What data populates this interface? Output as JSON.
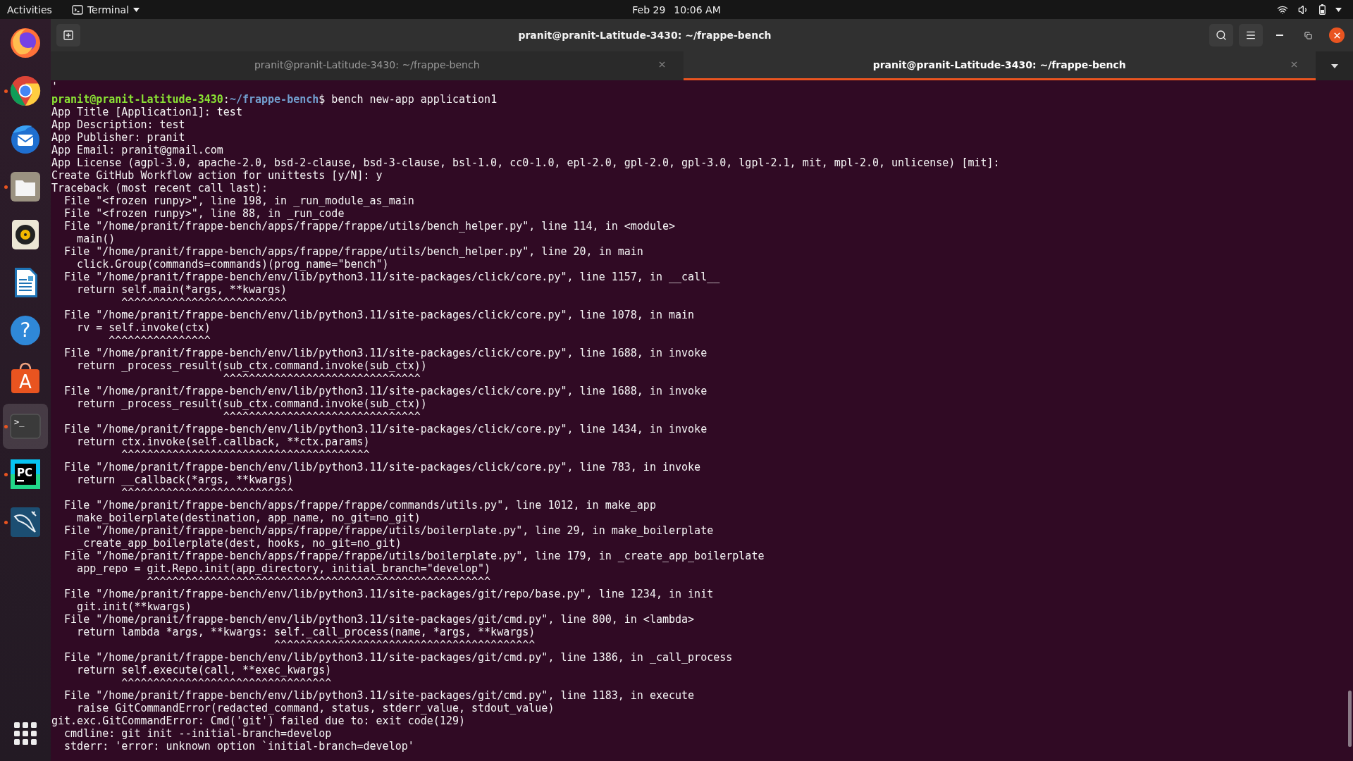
{
  "top_bar": {
    "activities": "Activities",
    "app_menu": "Terminal",
    "date": "Feb 29",
    "time": "10:06 AM"
  },
  "dock": [
    {
      "kind": "fox",
      "running": false,
      "selected": false
    },
    {
      "kind": "chrome",
      "running": true,
      "selected": false
    },
    {
      "kind": "mail",
      "running": false,
      "selected": false
    },
    {
      "kind": "files",
      "running": true,
      "selected": false
    },
    {
      "kind": "music",
      "running": false,
      "selected": false
    },
    {
      "kind": "document",
      "running": false,
      "selected": false
    },
    {
      "kind": "help",
      "label": "?",
      "running": false,
      "selected": false
    },
    {
      "kind": "store",
      "label": "A",
      "running": false,
      "selected": false
    },
    {
      "kind": "terminal",
      "label": ">_",
      "running": true,
      "selected": true
    },
    {
      "kind": "ide",
      "label": "PC",
      "running": true,
      "selected": false
    },
    {
      "kind": "database",
      "running": true,
      "selected": false
    }
  ],
  "window": {
    "title": "pranit@pranit-Latitude-3430: ~/frappe-bench"
  },
  "tabs": [
    {
      "title": "pranit@pranit-Latitude-3430: ~/frappe-bench",
      "selected": false
    },
    {
      "title": "pranit@pranit-Latitude-3430: ~/frappe-bench",
      "selected": true
    }
  ],
  "terminal": {
    "lines": [
      {
        "kind": "output",
        "text": "'"
      },
      {
        "kind": "prompt",
        "user": "pranit@pranit-Latitude-3430",
        "separator": ":",
        "path": "~/frappe-bench",
        "command": "$ bench new-app application1"
      },
      {
        "kind": "output",
        "text": "App Title [Application1]: test"
      },
      {
        "kind": "output",
        "text": "App Description: test"
      },
      {
        "kind": "output",
        "text": "App Publisher: pranit"
      },
      {
        "kind": "output",
        "text": "App Email: pranit@gmail.com"
      },
      {
        "kind": "output",
        "text": "App License (agpl-3.0, apache-2.0, bsd-2-clause, bsd-3-clause, bsl-1.0, cc0-1.0, epl-2.0, gpl-2.0, gpl-3.0, lgpl-2.1, mit, mpl-2.0, unlicense) [mit]:"
      },
      {
        "kind": "output",
        "text": "Create GitHub Workflow action for unittests [y/N]: y"
      },
      {
        "kind": "output",
        "text": "Traceback (most recent call last):"
      },
      {
        "kind": "output",
        "text": "  File \"<frozen runpy>\", line 198, in _run_module_as_main"
      },
      {
        "kind": "output",
        "text": "  File \"<frozen runpy>\", line 88, in _run_code"
      },
      {
        "kind": "output",
        "text": "  File \"/home/pranit/frappe-bench/apps/frappe/frappe/utils/bench_helper.py\", line 114, in <module>"
      },
      {
        "kind": "output",
        "text": "    main()"
      },
      {
        "kind": "output",
        "text": "  File \"/home/pranit/frappe-bench/apps/frappe/frappe/utils/bench_helper.py\", line 20, in main"
      },
      {
        "kind": "output",
        "text": "    click.Group(commands=commands)(prog_name=\"bench\")"
      },
      {
        "kind": "output",
        "text": "  File \"/home/pranit/frappe-bench/env/lib/python3.11/site-packages/click/core.py\", line 1157, in __call__"
      },
      {
        "kind": "output",
        "text": "    return self.main(*args, **kwargs)"
      },
      {
        "kind": "output",
        "text": "           ^^^^^^^^^^^^^^^^^^^^^^^^^^"
      },
      {
        "kind": "output",
        "text": "  File \"/home/pranit/frappe-bench/env/lib/python3.11/site-packages/click/core.py\", line 1078, in main"
      },
      {
        "kind": "output",
        "text": "    rv = self.invoke(ctx)"
      },
      {
        "kind": "output",
        "text": "         ^^^^^^^^^^^^^^^^"
      },
      {
        "kind": "output",
        "text": "  File \"/home/pranit/frappe-bench/env/lib/python3.11/site-packages/click/core.py\", line 1688, in invoke"
      },
      {
        "kind": "output",
        "text": "    return _process_result(sub_ctx.command.invoke(sub_ctx))"
      },
      {
        "kind": "output",
        "text": "                           ^^^^^^^^^^^^^^^^^^^^^^^^^^^^^^^"
      },
      {
        "kind": "output",
        "text": "  File \"/home/pranit/frappe-bench/env/lib/python3.11/site-packages/click/core.py\", line 1688, in invoke"
      },
      {
        "kind": "output",
        "text": "    return _process_result(sub_ctx.command.invoke(sub_ctx))"
      },
      {
        "kind": "output",
        "text": "                           ^^^^^^^^^^^^^^^^^^^^^^^^^^^^^^^"
      },
      {
        "kind": "output",
        "text": "  File \"/home/pranit/frappe-bench/env/lib/python3.11/site-packages/click/core.py\", line 1434, in invoke"
      },
      {
        "kind": "output",
        "text": "    return ctx.invoke(self.callback, **ctx.params)"
      },
      {
        "kind": "output",
        "text": "           ^^^^^^^^^^^^^^^^^^^^^^^^^^^^^^^^^^^^^^^"
      },
      {
        "kind": "output",
        "text": "  File \"/home/pranit/frappe-bench/env/lib/python3.11/site-packages/click/core.py\", line 783, in invoke"
      },
      {
        "kind": "output",
        "text": "    return __callback(*args, **kwargs)"
      },
      {
        "kind": "output",
        "text": "           ^^^^^^^^^^^^^^^^^^^^^^^^^^^"
      },
      {
        "kind": "output",
        "text": "  File \"/home/pranit/frappe-bench/apps/frappe/frappe/commands/utils.py\", line 1012, in make_app"
      },
      {
        "kind": "output",
        "text": "    make_boilerplate(destination, app_name, no_git=no_git)"
      },
      {
        "kind": "output",
        "text": "  File \"/home/pranit/frappe-bench/apps/frappe/frappe/utils/boilerplate.py\", line 29, in make_boilerplate"
      },
      {
        "kind": "output",
        "text": "    _create_app_boilerplate(dest, hooks, no_git=no_git)"
      },
      {
        "kind": "output",
        "text": "  File \"/home/pranit/frappe-bench/apps/frappe/frappe/utils/boilerplate.py\", line 179, in _create_app_boilerplate"
      },
      {
        "kind": "output",
        "text": "    app_repo = git.Repo.init(app_directory, initial_branch=\"develop\")"
      },
      {
        "kind": "output",
        "text": "               ^^^^^^^^^^^^^^^^^^^^^^^^^^^^^^^^^^^^^^^^^^^^^^^^^^^^^^"
      },
      {
        "kind": "output",
        "text": "  File \"/home/pranit/frappe-bench/env/lib/python3.11/site-packages/git/repo/base.py\", line 1234, in init"
      },
      {
        "kind": "output",
        "text": "    git.init(**kwargs)"
      },
      {
        "kind": "output",
        "text": "  File \"/home/pranit/frappe-bench/env/lib/python3.11/site-packages/git/cmd.py\", line 800, in <lambda>"
      },
      {
        "kind": "output",
        "text": "    return lambda *args, **kwargs: self._call_process(name, *args, **kwargs)"
      },
      {
        "kind": "output",
        "text": "                                   ^^^^^^^^^^^^^^^^^^^^^^^^^^^^^^^^^^^^^^^^^"
      },
      {
        "kind": "output",
        "text": "  File \"/home/pranit/frappe-bench/env/lib/python3.11/site-packages/git/cmd.py\", line 1386, in _call_process"
      },
      {
        "kind": "output",
        "text": "    return self.execute(call, **exec_kwargs)"
      },
      {
        "kind": "output",
        "text": "           ^^^^^^^^^^^^^^^^^^^^^^^^^^^^^^^^^"
      },
      {
        "kind": "output",
        "text": "  File \"/home/pranit/frappe-bench/env/lib/python3.11/site-packages/git/cmd.py\", line 1183, in execute"
      },
      {
        "kind": "output",
        "text": "    raise GitCommandError(redacted_command, status, stderr_value, stdout_value)"
      },
      {
        "kind": "output",
        "text": "git.exc.GitCommandError: Cmd('git') failed due to: exit code(129)"
      },
      {
        "kind": "output",
        "text": "  cmdline: git init --initial-branch=develop"
      },
      {
        "kind": "output",
        "text": "  stderr: 'error: unknown option `initial-branch=develop'"
      }
    ]
  }
}
